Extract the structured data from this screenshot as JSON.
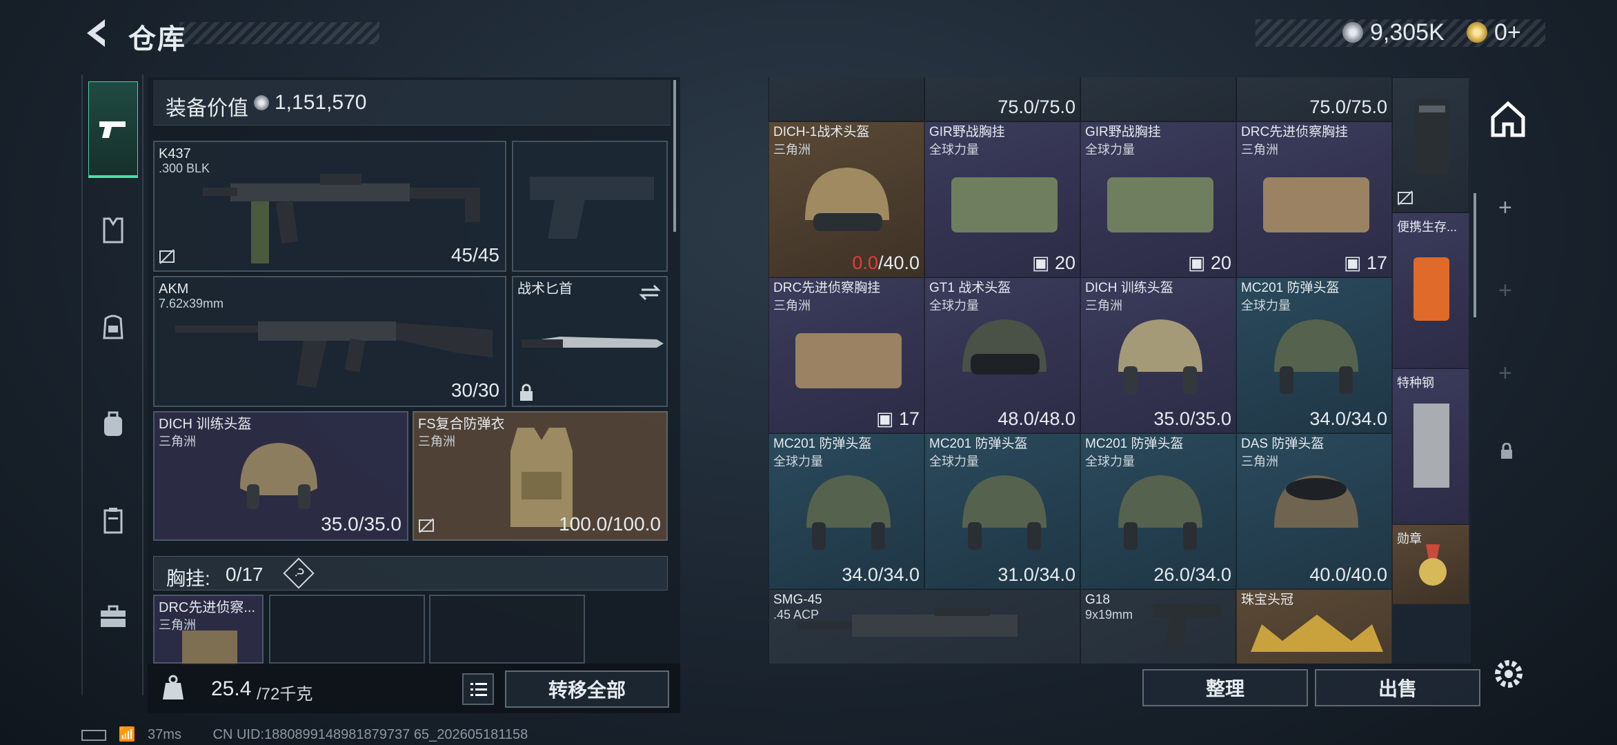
{
  "header": {
    "title": "仓库",
    "currency1": "9,305K",
    "currency2": "0+"
  },
  "left": {
    "value_label": "装备价值",
    "value": "1,151,570",
    "weapon1": {
      "name": "K437",
      "ammo": ".300 BLK",
      "durability": "45/45"
    },
    "weapon2": {
      "name": "AKM",
      "ammo": "7.62x39mm",
      "durability": "30/30"
    },
    "melee": {
      "name": "战术匕首"
    },
    "helmet": {
      "name": "DICH 训练头盔",
      "sub": "三角洲",
      "durability": "35.0/35.0"
    },
    "armor": {
      "name": "FS复合防弹衣",
      "sub": "三角洲",
      "durability": "100.0/100.0"
    },
    "chest": {
      "label": "胸挂:",
      "count": "0/17",
      "help": "?"
    },
    "chest_item": {
      "name": "DRC先进侦察...",
      "sub": "三角洲"
    },
    "weight": "25.4",
    "weight_max": "/72千克",
    "transfer_all": "转移全部"
  },
  "grid": {
    "row0": [
      "75.0/75.0",
      "75.0/75.0"
    ],
    "cells": [
      {
        "name": "DICH-1战术头盔",
        "sub": "三角洲",
        "dur_red": "0.0",
        "dur": "/40.0",
        "bg": "brown"
      },
      {
        "name": "GIR野战胸挂",
        "sub": "全球力量",
        "count": "20",
        "bg": "purple"
      },
      {
        "name": "GIR野战胸挂",
        "sub": "全球力量",
        "count": "20",
        "bg": "purple"
      },
      {
        "name": "DRC先进侦察胸挂",
        "sub": "三角洲",
        "count": "17",
        "bg": "purple"
      },
      {
        "name": "DRC先进侦察胸挂",
        "sub": "三角洲",
        "count": "17",
        "bg": "purple"
      },
      {
        "name": "GT1 战术头盔",
        "sub": "全球力量",
        "dur": "48.0/48.0",
        "bg": "purple"
      },
      {
        "name": "DICH 训练头盔",
        "sub": "三角洲",
        "dur": "35.0/35.0",
        "bg": "purple"
      },
      {
        "name": "MC201 防弹头盔",
        "sub": "全球力量",
        "dur": "34.0/34.0",
        "bg": "teal"
      },
      {
        "name": "MC201 防弹头盔",
        "sub": "全球力量",
        "dur": "34.0/34.0",
        "bg": "teal"
      },
      {
        "name": "MC201 防弹头盔",
        "sub": "全球力量",
        "dur": "31.0/34.0",
        "bg": "teal"
      },
      {
        "name": "MC201 防弹头盔",
        "sub": "全球力量",
        "dur": "26.0/34.0",
        "bg": "teal"
      },
      {
        "name": "DAS 防弹头盔",
        "sub": "三角洲",
        "dur": "40.0/40.0",
        "bg": "teal"
      },
      {
        "name": "SMG-45",
        "sub": ".45 ACP",
        "bg": "dark"
      },
      {
        "name": "G18",
        "sub": "9x19mm",
        "bg": "dark"
      },
      {
        "name": "珠宝头冠",
        "sub": "",
        "bg": "brown"
      }
    ],
    "side": [
      "便携生存...",
      "特种钢",
      "勋章"
    ]
  },
  "buttons": {
    "sort": "整理",
    "sell": "出售"
  },
  "status": {
    "ping": "37ms",
    "uid": "CN UID:1880899148981879737 65_202605181158"
  }
}
